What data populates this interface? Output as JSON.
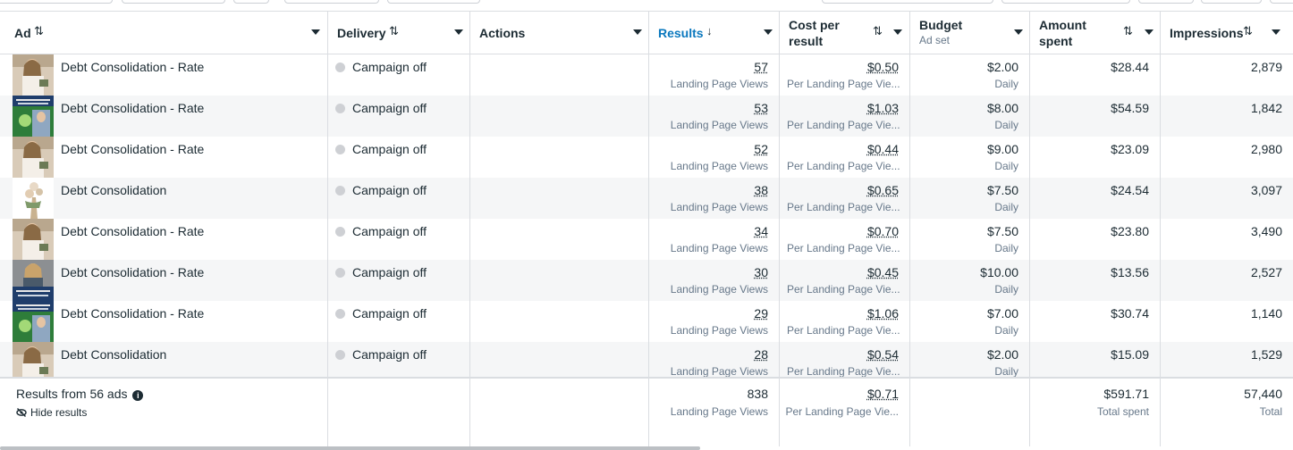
{
  "columns": {
    "ad": "Ad",
    "delivery": "Delivery",
    "actions": "Actions",
    "results": "Results",
    "cost_line1": "Cost per",
    "cost_line2": "result",
    "budget": "Budget",
    "budget_sub": "Ad set",
    "amount_line1": "Amount",
    "amount_line2": "spent",
    "impressions": "Impressions"
  },
  "sort_glyphs": {
    "both": "⇅",
    "down": "↓"
  },
  "rows": [
    {
      "name": "Debt Consolidation - Rate",
      "delivery": "Campaign off",
      "results": "57",
      "results_sub": "Landing Page Views",
      "cost": "$0.50",
      "cost_sub": "Per Landing Page Vie...",
      "budget": "$2.00",
      "budget_sub": "Daily",
      "spent": "$28.44",
      "impressions": "2,879",
      "thumb": "woman-kitchen"
    },
    {
      "name": "Debt Consolidation - Rate",
      "delivery": "Campaign off",
      "results": "53",
      "results_sub": "Landing Page Views",
      "cost": "$1.03",
      "cost_sub": "Per Landing Page Vie...",
      "budget": "$8.00",
      "budget_sub": "Daily",
      "spent": "$54.59",
      "impressions": "1,842",
      "thumb": "banner-green"
    },
    {
      "name": "Debt Consolidation - Rate",
      "delivery": "Campaign off",
      "results": "52",
      "results_sub": "Landing Page Views",
      "cost": "$0.44",
      "cost_sub": "Per Landing Page Vie...",
      "budget": "$9.00",
      "budget_sub": "Daily",
      "spent": "$23.09",
      "impressions": "2,980",
      "thumb": "woman-kitchen"
    },
    {
      "name": "Debt Consolidation",
      "delivery": "Campaign off",
      "results": "38",
      "results_sub": "Landing Page Views",
      "cost": "$0.65",
      "cost_sub": "Per Landing Page Vie...",
      "budget": "$7.50",
      "budget_sub": "Daily",
      "spent": "$24.54",
      "impressions": "3,097",
      "thumb": "flowers"
    },
    {
      "name": "Debt Consolidation - Rate",
      "delivery": "Campaign off",
      "results": "34",
      "results_sub": "Landing Page Views",
      "cost": "$0.70",
      "cost_sub": "Per Landing Page Vie...",
      "budget": "$7.50",
      "budget_sub": "Daily",
      "spent": "$23.80",
      "impressions": "3,490",
      "thumb": "woman-kitchen"
    },
    {
      "name": "Debt Consolidation - Rate",
      "delivery": "Campaign off",
      "results": "30",
      "results_sub": "Landing Page Views",
      "cost": "$0.45",
      "cost_sub": "Per Landing Page Vie...",
      "budget": "$10.00",
      "budget_sub": "Daily",
      "spent": "$13.56",
      "impressions": "2,527",
      "thumb": "woman-office"
    },
    {
      "name": "Debt Consolidation - Rate",
      "delivery": "Campaign off",
      "results": "29",
      "results_sub": "Landing Page Views",
      "cost": "$1.06",
      "cost_sub": "Per Landing Page Vie...",
      "budget": "$7.00",
      "budget_sub": "Daily",
      "spent": "$30.74",
      "impressions": "1,140",
      "thumb": "banner-green"
    },
    {
      "name": "Debt Consolidation",
      "delivery": "Campaign off",
      "results": "28",
      "results_sub": "Landing Page Views",
      "cost": "$0.54",
      "cost_sub": "Per Landing Page Vie...",
      "budget": "$2.00",
      "budget_sub": "Daily",
      "spent": "$15.09",
      "impressions": "1,529",
      "thumb": "woman-kitchen"
    }
  ],
  "footer": {
    "title": "Results from 56 ads",
    "hide": "Hide results",
    "results": "838",
    "results_sub": "Landing Page Views",
    "cost": "$0.71",
    "cost_sub": "Per Landing Page Vie...",
    "spent": "$591.71",
    "spent_sub": "Total spent",
    "impressions": "57,440",
    "impressions_sub": "Total"
  },
  "colors": {
    "accent": "#0a78be",
    "text": "#1c2b33",
    "muted": "#67788a",
    "alt_row": "#f5f6f7",
    "off_dot": "#ced0d4"
  }
}
